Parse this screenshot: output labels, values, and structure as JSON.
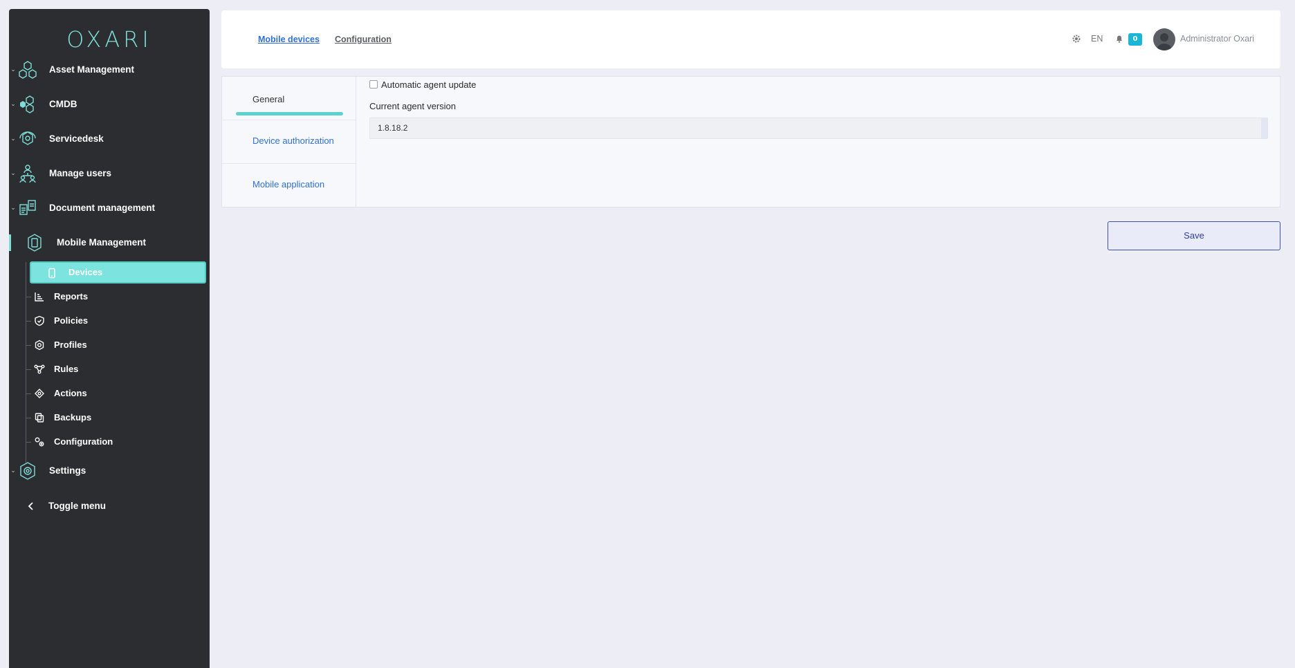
{
  "brand": {
    "logo_text": "OXARI",
    "accent": "#7fded8"
  },
  "sidebar": {
    "items": [
      {
        "label": "Asset Management",
        "icon": "hexagon-cluster-icon"
      },
      {
        "label": "CMDB",
        "icon": "hexagon-dots-icon"
      },
      {
        "label": "Servicedesk",
        "icon": "headset-hexagon-icon"
      },
      {
        "label": "Manage users",
        "icon": "users-tree-icon"
      },
      {
        "label": "Document management",
        "icon": "documents-icon"
      },
      {
        "label": "Mobile Management",
        "icon": "mobile-hexagon-icon"
      }
    ],
    "submenu": [
      {
        "label": "Devices",
        "icon": "phone-icon",
        "selected": true
      },
      {
        "label": "Reports",
        "icon": "bar-chart-icon"
      },
      {
        "label": "Policies",
        "icon": "shield-check-icon"
      },
      {
        "label": "Profiles",
        "icon": "gear-icon"
      },
      {
        "label": "Rules",
        "icon": "flow-icon"
      },
      {
        "label": "Actions",
        "icon": "target-icon"
      },
      {
        "label": "Backups",
        "icon": "copy-icon"
      },
      {
        "label": "Configuration",
        "icon": "gears-icon"
      }
    ],
    "settings_label": "Settings",
    "toggle_label": "Toggle menu"
  },
  "header": {
    "breadcrumbs": [
      "Mobile devices",
      "Configuration"
    ],
    "language": "EN",
    "notifications_count": "0",
    "user_name": "Administrator Oxari"
  },
  "config": {
    "tabs": [
      "General",
      "Device authorization",
      "Mobile application"
    ],
    "auto_update_label": "Automatic agent update",
    "auto_update_checked": false,
    "version_label": "Current agent version",
    "version_value": "1.8.18.2"
  },
  "actions": {
    "save_label": "Save"
  }
}
